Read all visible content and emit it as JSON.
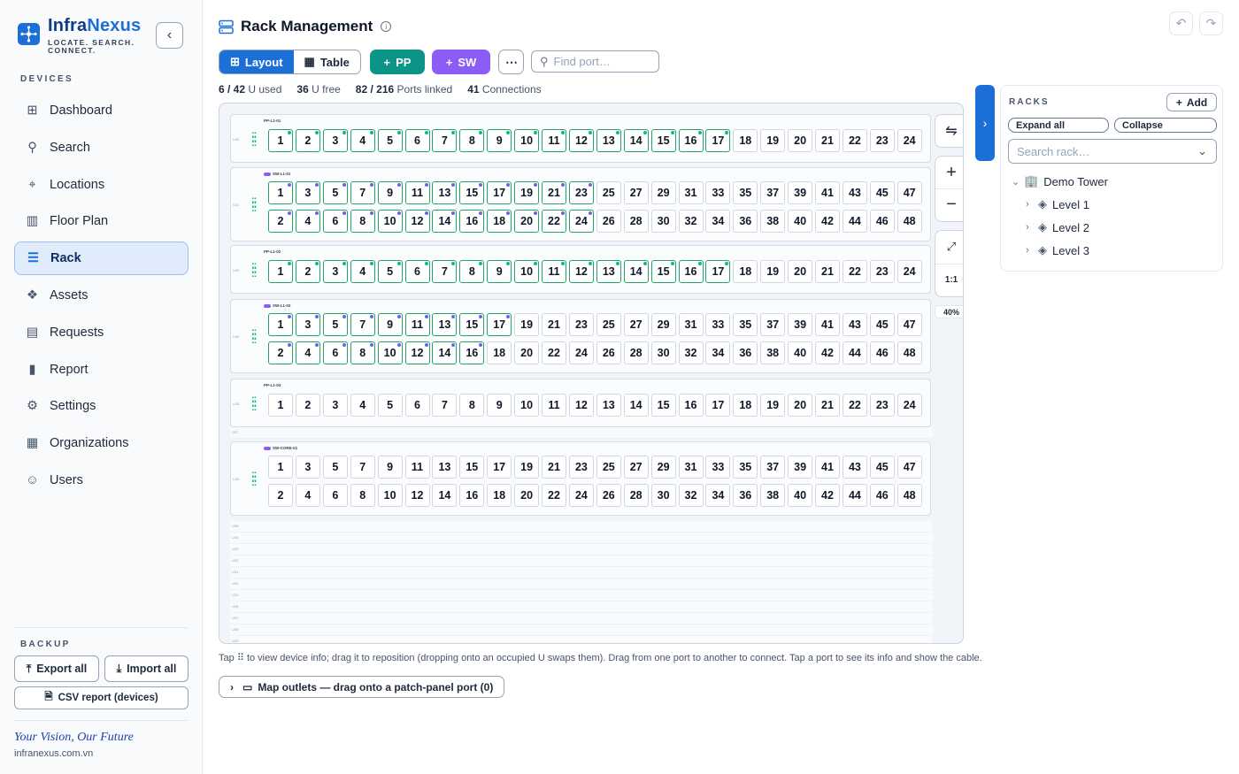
{
  "brand": {
    "name_part1": "Infra",
    "name_part2": "Nexus",
    "tagline": "LOCATE. SEARCH. CONNECT."
  },
  "sidebar": {
    "devices_label": "DEVICES",
    "items": [
      {
        "label": "Dashboard",
        "icon": "grid-icon"
      },
      {
        "label": "Search",
        "icon": "search-icon"
      },
      {
        "label": "Locations",
        "icon": "pin-icon"
      },
      {
        "label": "Floor Plan",
        "icon": "map-icon"
      },
      {
        "label": "Rack",
        "icon": "rack-icon",
        "active": true
      },
      {
        "label": "Assets",
        "icon": "boxes-icon"
      },
      {
        "label": "Requests",
        "icon": "clipboard-icon"
      },
      {
        "label": "Report",
        "icon": "chart-icon"
      },
      {
        "label": "Settings",
        "icon": "gear-icon"
      },
      {
        "label": "Organizations",
        "icon": "building-icon"
      },
      {
        "label": "Users",
        "icon": "users-icon"
      }
    ],
    "backup_label": "BACKUP",
    "export_all": "Export all",
    "import_all": "Import all",
    "csv_report": "CSV report (devices)",
    "vision": "Your Vision, Our Future",
    "site": "infranexus.com.vn"
  },
  "header": {
    "title": "Rack Management"
  },
  "toolbar": {
    "layout": "Layout",
    "table": "Table",
    "pp": "PP",
    "sw": "SW",
    "more": "⋯",
    "find_placeholder": "Find port…"
  },
  "stats": {
    "used": "6 / 42",
    "used_label": "U used",
    "free": "36",
    "free_label": "U free",
    "ports": "82 / 216",
    "ports_label": "Ports linked",
    "conns": "41",
    "conns_label": "Connections"
  },
  "rack": {
    "devices": [
      {
        "label": "PP-L1-01",
        "u": "U42",
        "type": "pp",
        "ports": 24,
        "linked": 17
      },
      {
        "label": "SW-L1-01",
        "u": "U41",
        "type": "sw",
        "ports": 48,
        "linked": 24
      },
      {
        "label": "PP-L1-02",
        "u": "U40",
        "type": "pp",
        "ports": 24,
        "linked": 17
      },
      {
        "label": "SW-L1-02",
        "u": "U39",
        "type": "sw",
        "ports": 48,
        "linked": 17
      },
      {
        "label": "PP-L1-03",
        "u": "U38",
        "type": "pp",
        "ports": 24,
        "linked": 0
      },
      {
        "label": "SW-CORE-01",
        "u": "U36",
        "type": "sw",
        "ports": 48,
        "linked": 0
      }
    ],
    "empty_units": [
      "U37",
      "U35",
      "U34",
      "U33",
      "U32",
      "U31",
      "U30",
      "U29",
      "U28",
      "U27",
      "U26",
      "U25"
    ],
    "zoom": "40%",
    "fit_label": "1:1"
  },
  "hint": {
    "text_before": "Tap",
    "text_after": "to view device info; drag it to reposition (dropping onto an occupied U swaps them). Drag from one port to another to connect. Tap a port to see its info and show the cable."
  },
  "outlets": {
    "label": "Map outlets — drag onto a patch-panel port (0)"
  },
  "racks_panel": {
    "title": "RACKS",
    "add": "Add",
    "expand_all": "Expand all",
    "collapse": "Collapse",
    "search_placeholder": "Search rack…",
    "tree_root": "Demo Tower",
    "levels": [
      "Level 1",
      "Level 2",
      "Level 3"
    ]
  },
  "colors": {
    "accent": "#1d6fd8",
    "pp": "#0d9488",
    "sw": "#8b5cf6",
    "linked": "#22a36b"
  }
}
